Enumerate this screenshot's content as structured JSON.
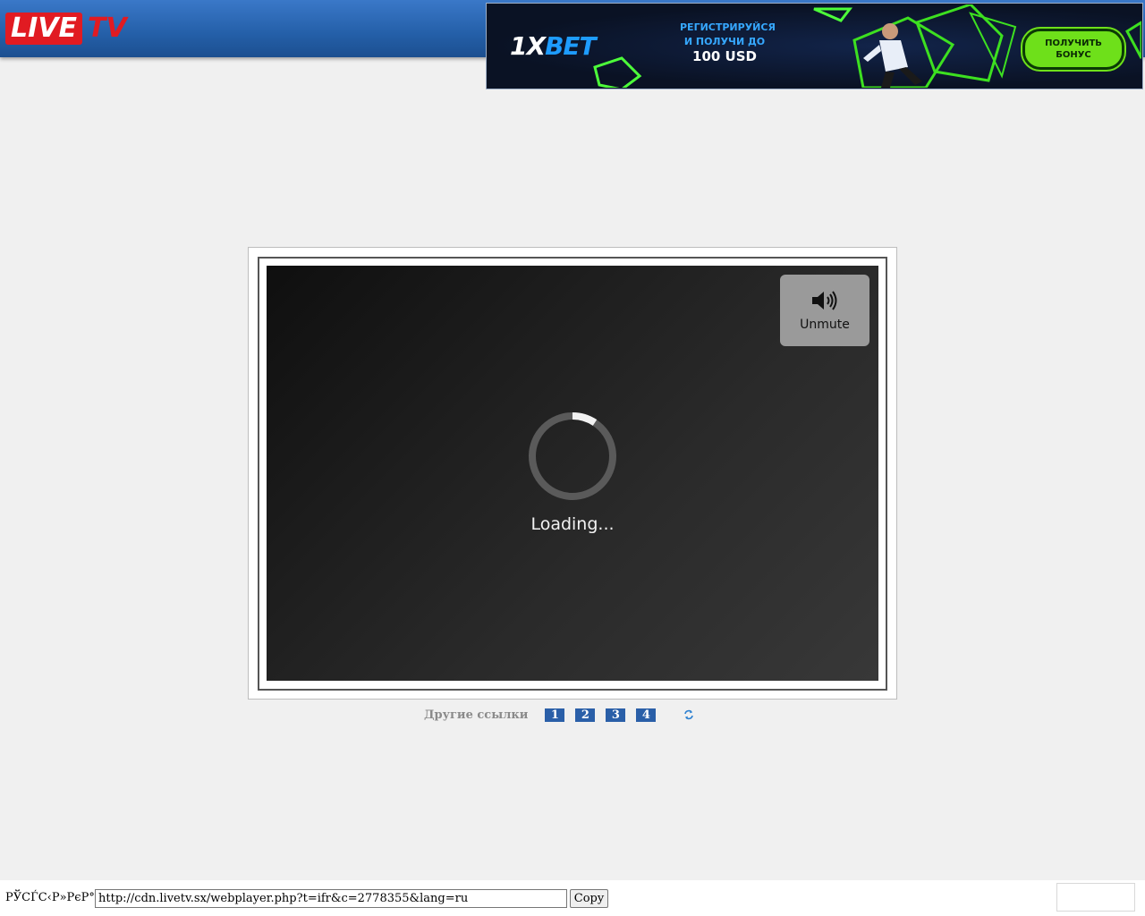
{
  "header": {
    "logo_live": "LIVE",
    "logo_tv": "TV"
  },
  "ad": {
    "brand_prefix": "1X",
    "brand_suffix": "BET",
    "line1": "РЕГИСТРИРУЙСЯ",
    "line2": "И ПОЛУЧИ ДО",
    "amount": "100 USD",
    "cta_line1": "ПОЛУЧИТЬ",
    "cta_line2": "БОНУС",
    "colors": {
      "accent_green": "#6ee01a",
      "accent_blue": "#1e9cff",
      "background": "#0b1426"
    }
  },
  "player": {
    "unmute_label": "Unmute",
    "unmute_icon": "speaker-icon",
    "loading_text": "Loading...",
    "spinner_icon": "loading-spinner-icon"
  },
  "links": {
    "label": "Другие ссылки",
    "items": [
      "1",
      "2",
      "3",
      "4"
    ],
    "refresh_icon": "refresh-icon"
  },
  "bottom": {
    "label": "РЎСЃС‹Р»РєР°:",
    "url_value": "http://cdn.livetv.sx/webplayer.php?t=ifr&c=2778355&lang=ru",
    "copy_label": "Copy"
  },
  "colors": {
    "header_blue": "#245fa8",
    "logo_red": "#e11b22",
    "link_badge": "#2a5fa8",
    "page_bg": "#f0f0f0"
  }
}
